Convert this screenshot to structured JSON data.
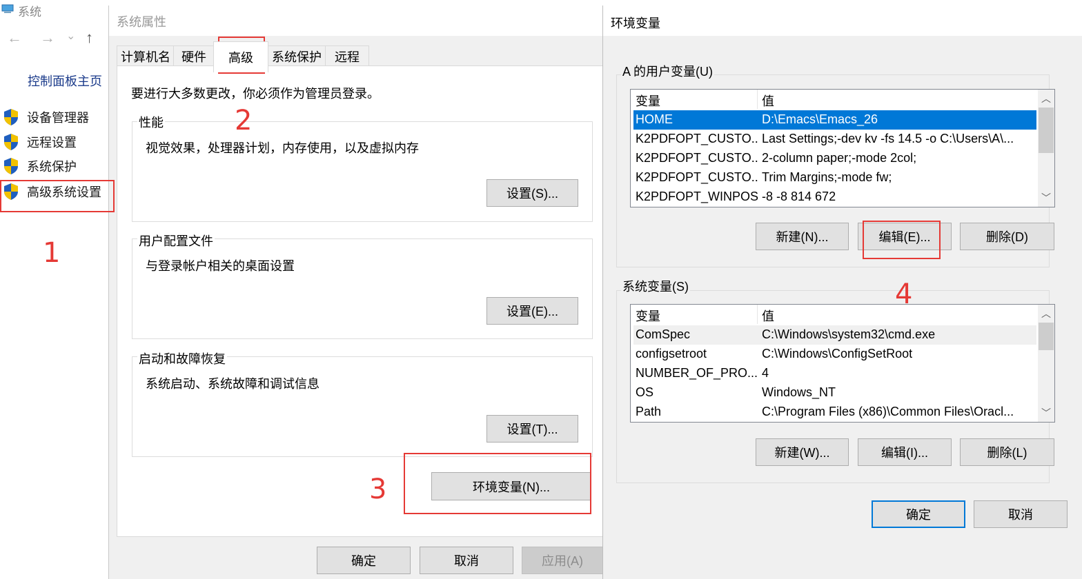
{
  "control_panel": {
    "title": "系统",
    "home": "控制面板主页",
    "links": [
      {
        "label": "设备管理器",
        "icon": "shield-icon"
      },
      {
        "label": "远程设置",
        "icon": "shield-icon"
      },
      {
        "label": "系统保护",
        "icon": "shield-icon"
      },
      {
        "label": "高级系统设置",
        "icon": "shield-icon"
      }
    ],
    "nav": {
      "back": "←",
      "forward": "→",
      "dropdown": "⌄",
      "up": "↑"
    }
  },
  "system_properties": {
    "title": "系统属性",
    "tabs": [
      "计算机名",
      "硬件",
      "高级",
      "系统保护",
      "远程"
    ],
    "active_tab": "高级",
    "admin_note": "要进行大多数更改，你必须作为管理员登录。",
    "groups": [
      {
        "label": "性能",
        "description": "视觉效果，处理器计划，内存使用，以及虚拟内存",
        "button": "设置(S)..."
      },
      {
        "label": "用户配置文件",
        "description": "与登录帐户相关的桌面设置",
        "button": "设置(E)..."
      },
      {
        "label": "启动和故障恢复",
        "description": "系统启动、系统故障和调试信息",
        "button": "设置(T)..."
      }
    ],
    "env_button": "环境变量(N)...",
    "ok": "确定",
    "cancel": "取消",
    "apply": "应用(A)"
  },
  "environment_variables": {
    "title": "环境变量",
    "user_group_label": "A 的用户变量(U)",
    "system_group_label": "系统变量(S)",
    "columns": [
      "变量",
      "值"
    ],
    "user_vars": [
      {
        "name": "HOME",
        "value": "D:\\Emacs\\Emacs_26"
      },
      {
        "name": "K2PDFOPT_CUSTO...",
        "value": "Last Settings;-dev kv -fs 14.5 -o C:\\Users\\A\\..."
      },
      {
        "name": "K2PDFOPT_CUSTO...",
        "value": "2-column paper;-mode 2col;"
      },
      {
        "name": "K2PDFOPT_CUSTO...",
        "value": "Trim Margins;-mode fw;"
      },
      {
        "name": "K2PDFOPT_WINPOS",
        "value": "-8 -8 814 672"
      }
    ],
    "system_vars": [
      {
        "name": "ComSpec",
        "value": "C:\\Windows\\system32\\cmd.exe"
      },
      {
        "name": "configsetroot",
        "value": "C:\\Windows\\ConfigSetRoot"
      },
      {
        "name": "NUMBER_OF_PRO...",
        "value": "4"
      },
      {
        "name": "OS",
        "value": "Windows_NT"
      },
      {
        "name": "Path",
        "value": "C:\\Program Files (x86)\\Common Files\\Oracl..."
      }
    ],
    "user_buttons": {
      "new": "新建(N)...",
      "edit": "编辑(E)...",
      "delete": "删除(D)"
    },
    "system_buttons": {
      "new": "新建(W)...",
      "edit": "编辑(I)...",
      "delete": "删除(L)"
    },
    "ok": "确定",
    "cancel": "取消"
  },
  "annotations": [
    "1",
    "2",
    "3",
    "4"
  ],
  "colors": {
    "annotation": "#e53935",
    "selection": "#0078d7",
    "shield_blue": "#1f5fbf",
    "shield_yellow": "#f2c200"
  }
}
